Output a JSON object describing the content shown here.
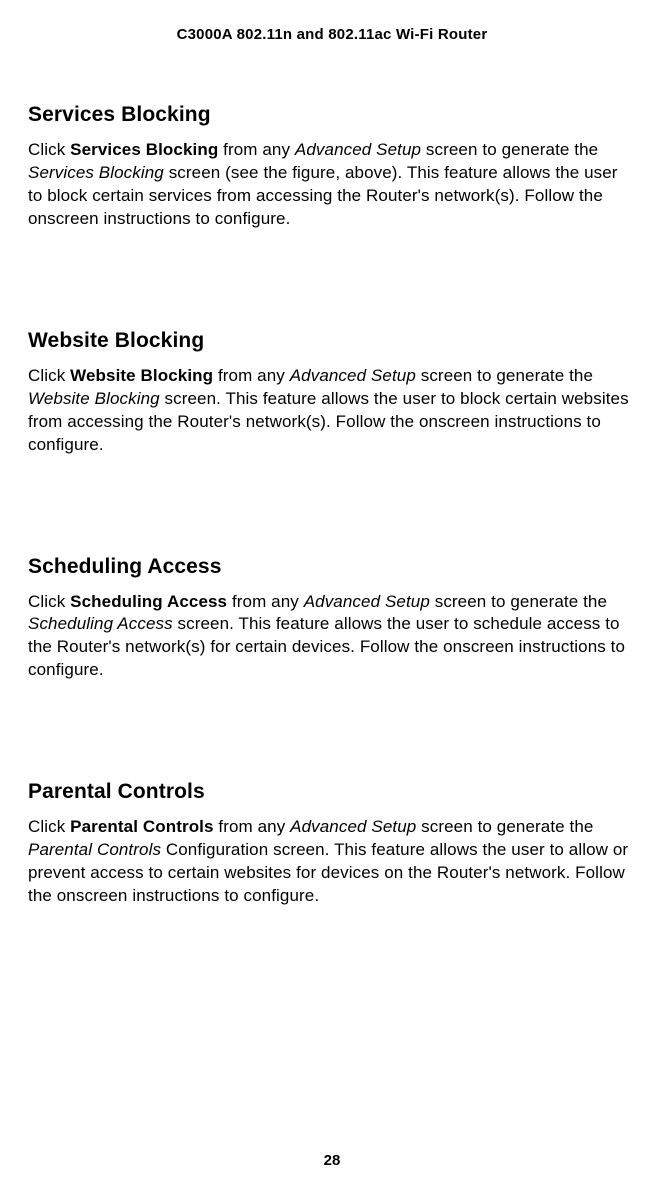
{
  "header": "C3000A 802.11n and 802.11ac Wi-Fi Router",
  "pageNumber": "28",
  "sections": [
    {
      "heading": "Services Blocking",
      "para": {
        "pre": "Click ",
        "boldName": "Services Blocking",
        "mid1": " from any ",
        "italFrom": "Advanced Setup",
        "mid2": " screen to generate the ",
        "italScreen": "Services Blocking",
        "tail": " screen (see the figure, above). This feature allows the user to block certain services from accessing the Router's network(s). Follow the onscreen instructions to configure."
      }
    },
    {
      "heading": "Website Blocking",
      "para": {
        "pre": "Click ",
        "boldName": "Website Blocking",
        "mid1": " from any ",
        "italFrom": "Advanced Setup",
        "mid2": " screen to generate the ",
        "italScreen": "Website Blocking",
        "tail": " screen. This feature allows the user to block certain websites from accessing the Router's network(s). Follow the onscreen instructions to configure."
      }
    },
    {
      "heading": "Scheduling Access",
      "para": {
        "pre": "Click ",
        "boldName": "Scheduling Access",
        "mid1": " from any ",
        "italFrom": "Advanced Setup",
        "mid2": " screen to generate the ",
        "italScreen": "Scheduling Access",
        "tail": " screen. This feature allows the user to schedule access to the Router's network(s) for certain devices. Follow the onscreen instructions to configure."
      }
    },
    {
      "heading": "Parental Controls",
      "para": {
        "pre": "Click ",
        "boldName": "Parental Controls",
        "mid1": " from any ",
        "italFrom": "Advanced Setup",
        "mid2": " screen to generate the ",
        "italScreen": "Parental Controls",
        "tail": " Configuration screen. This feature allows the user to allow or prevent access to certain websites for devices on the Router's network. Follow the onscreen instructions to configure."
      }
    }
  ]
}
